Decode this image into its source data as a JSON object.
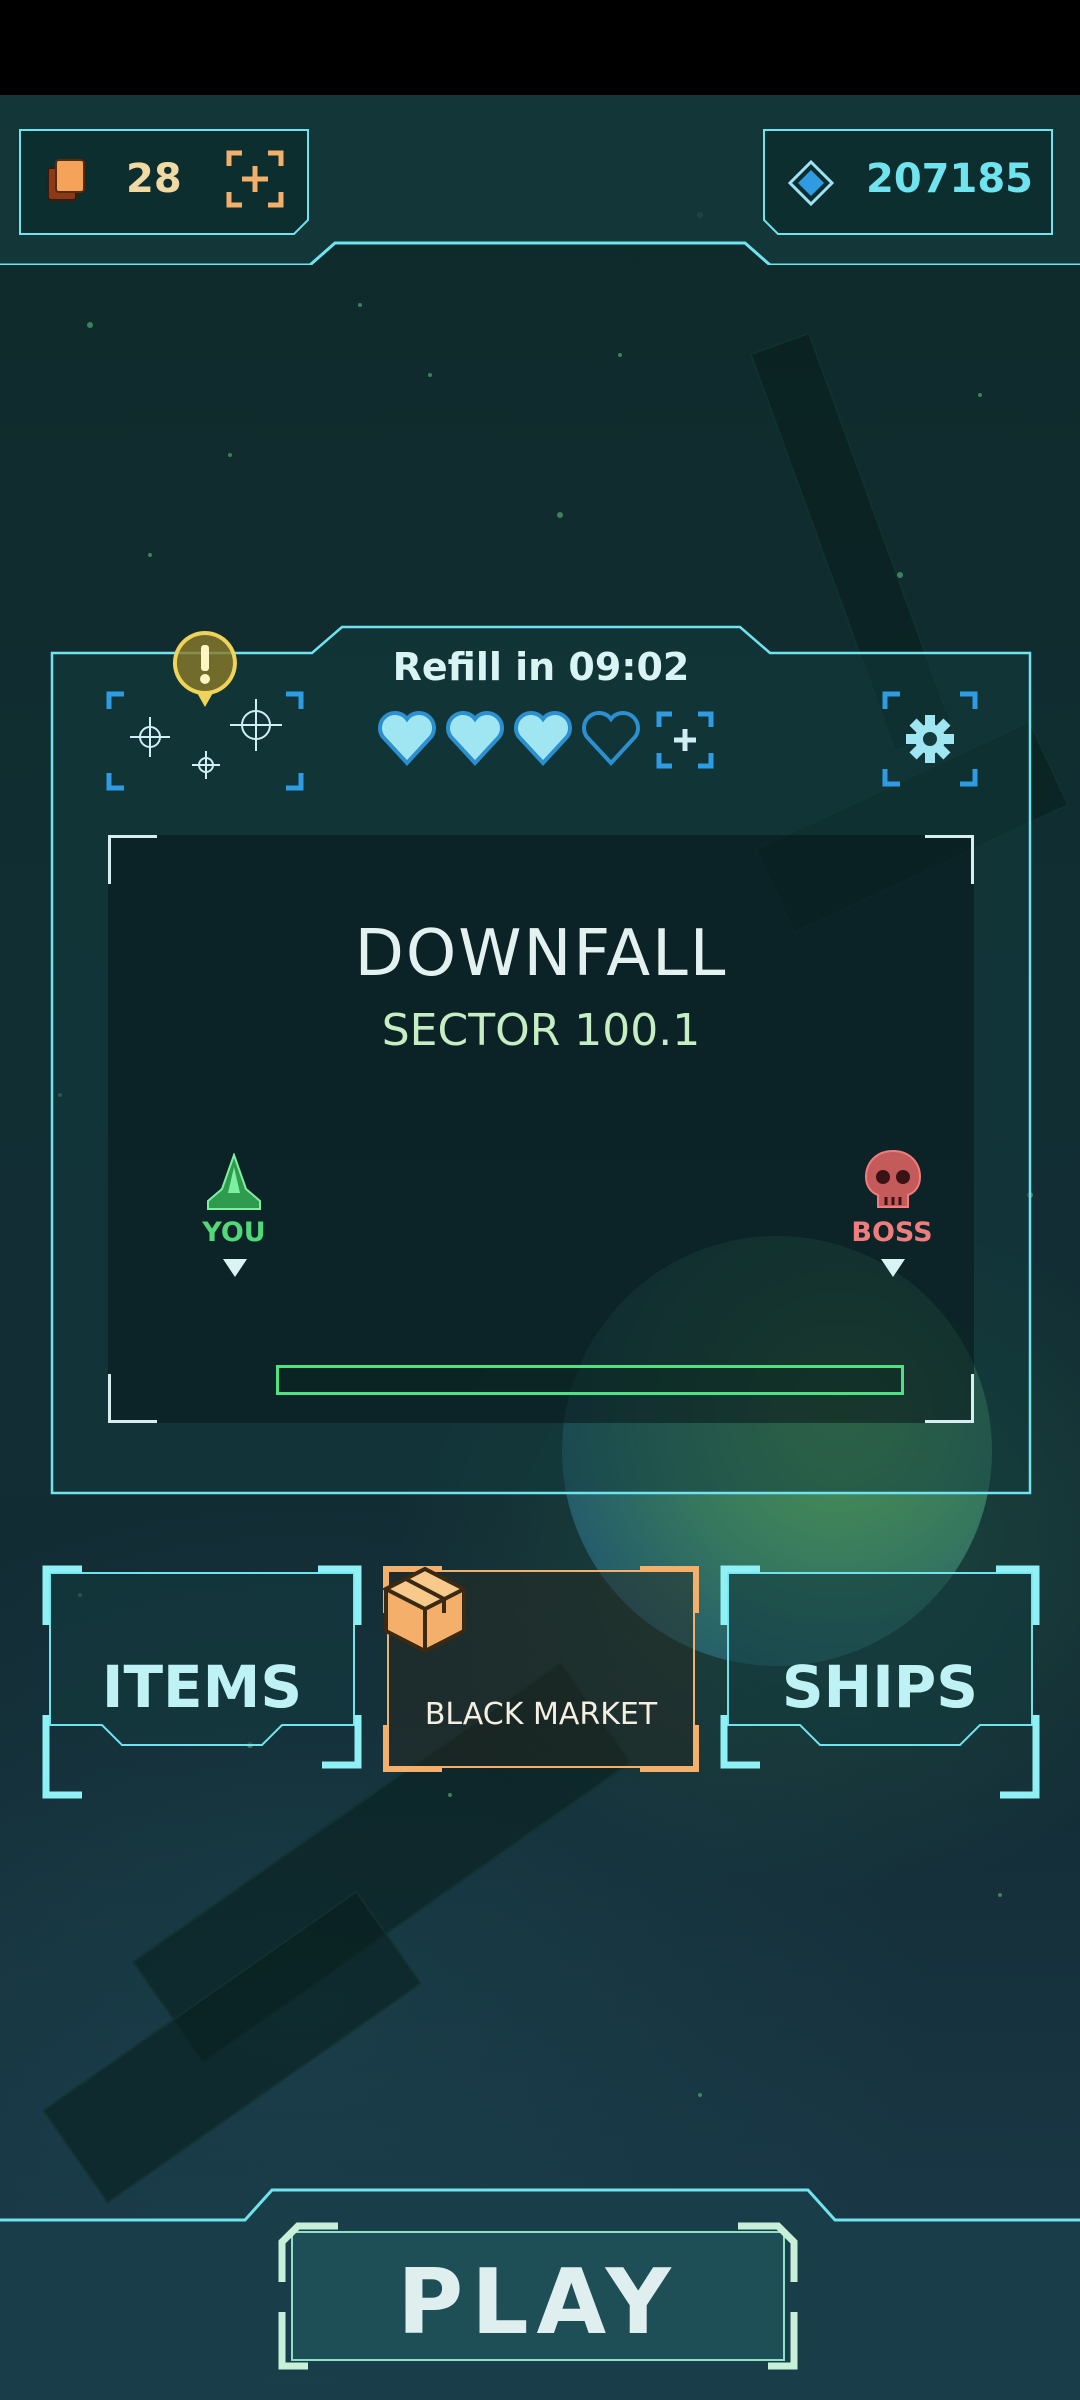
{
  "currency": {
    "cards": "28",
    "gems": "207185"
  },
  "mission": {
    "refill_text": "Refill in 09:02",
    "lives_full": 3,
    "lives_total": 4,
    "title": "DOWNFALL",
    "sector": "SECTOR 100.1",
    "you_label": "YOU",
    "boss_label": "BOSS",
    "progress": 0
  },
  "menu": {
    "items_label": "ITEMS",
    "black_market_label": "BLACK MARKET",
    "ships_label": "SHIPS"
  },
  "play_label": "PLAY",
  "colors": {
    "accent_cyan": "#6fe3ee",
    "accent_orange": "#f4b06a",
    "player_green": "#53d778",
    "boss_red": "#f07d7d",
    "hud_blue": "#2f9be3"
  },
  "icons": [
    "cards-icon",
    "add-icon",
    "gem-icon",
    "radar-icon",
    "alert-icon",
    "heart-icon",
    "settings-gear-icon",
    "player-ship-icon",
    "boss-skull-icon",
    "crate-icon"
  ]
}
